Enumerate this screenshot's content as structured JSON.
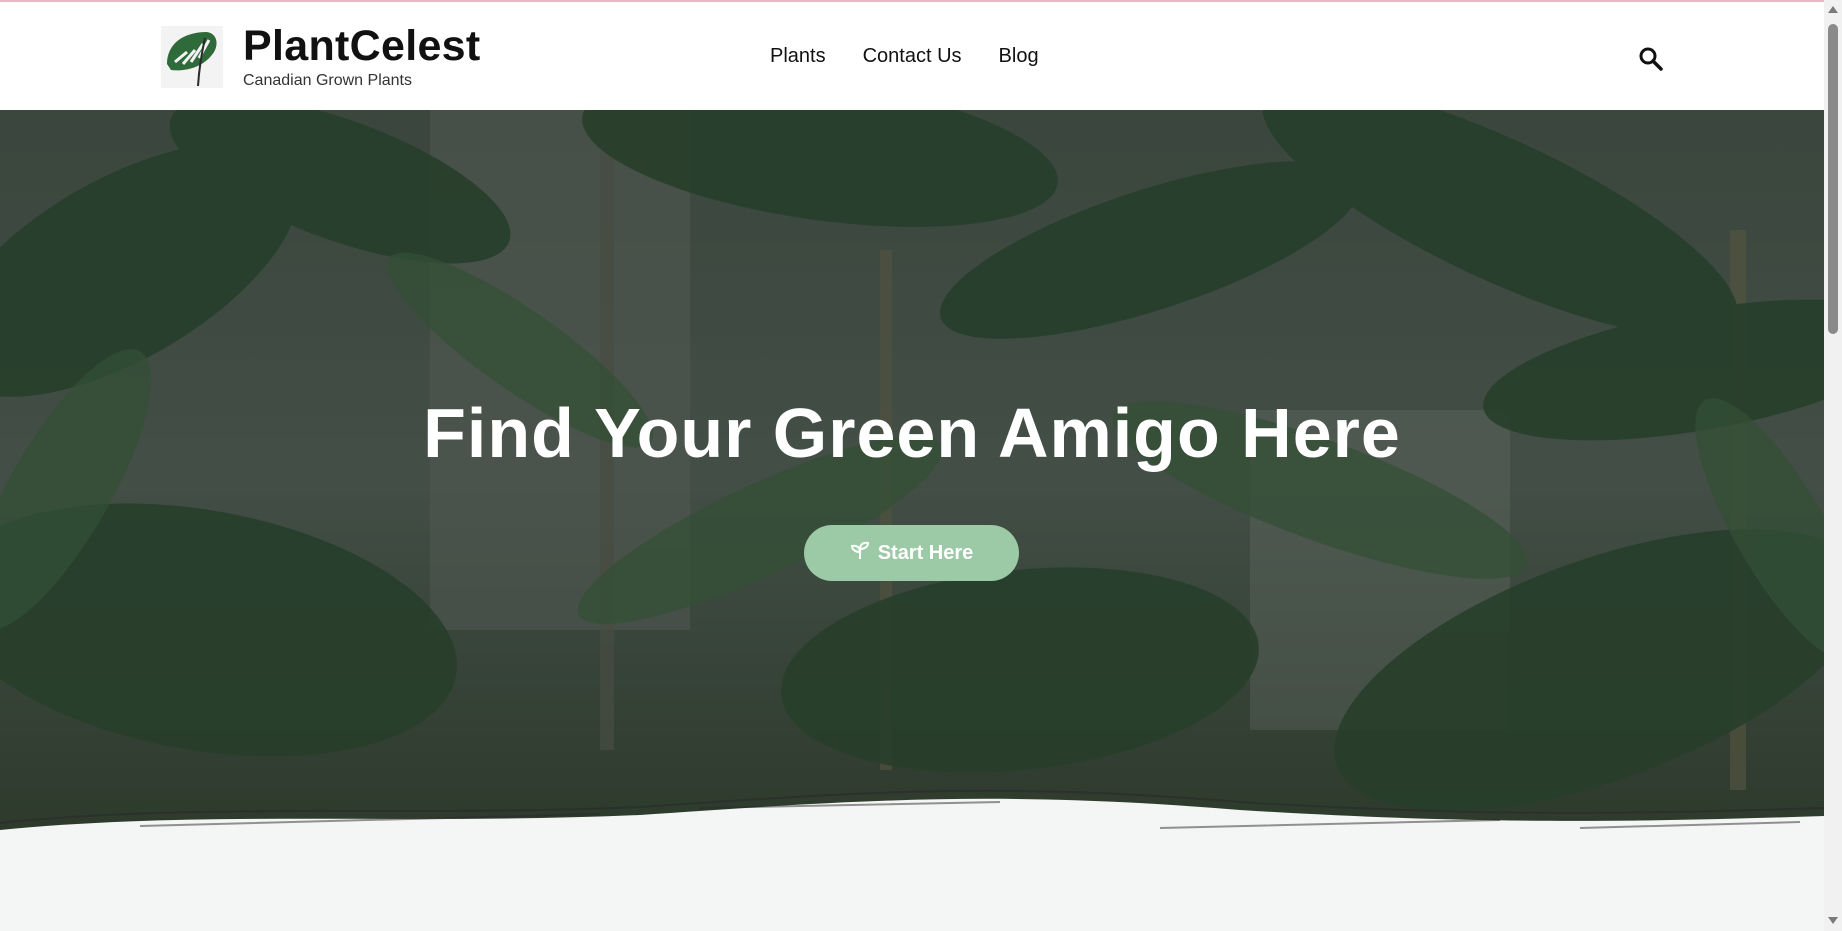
{
  "header": {
    "brand_name": "PlantCelest",
    "brand_tagline": "Canadian Grown Plants",
    "logo_icon": "monstera-leaf-icon",
    "nav": [
      {
        "label": "Plants"
      },
      {
        "label": "Contact Us"
      },
      {
        "label": "Blog"
      }
    ],
    "search_icon": "search-icon"
  },
  "hero": {
    "title": "Find Your Green Amigo Here",
    "cta_label": "Start Here",
    "cta_icon": "sprout-icon"
  },
  "colors": {
    "accent": "#9cc9a6",
    "hero_overlay": "#2f3d32",
    "page_bg": "#f4f6f5"
  }
}
